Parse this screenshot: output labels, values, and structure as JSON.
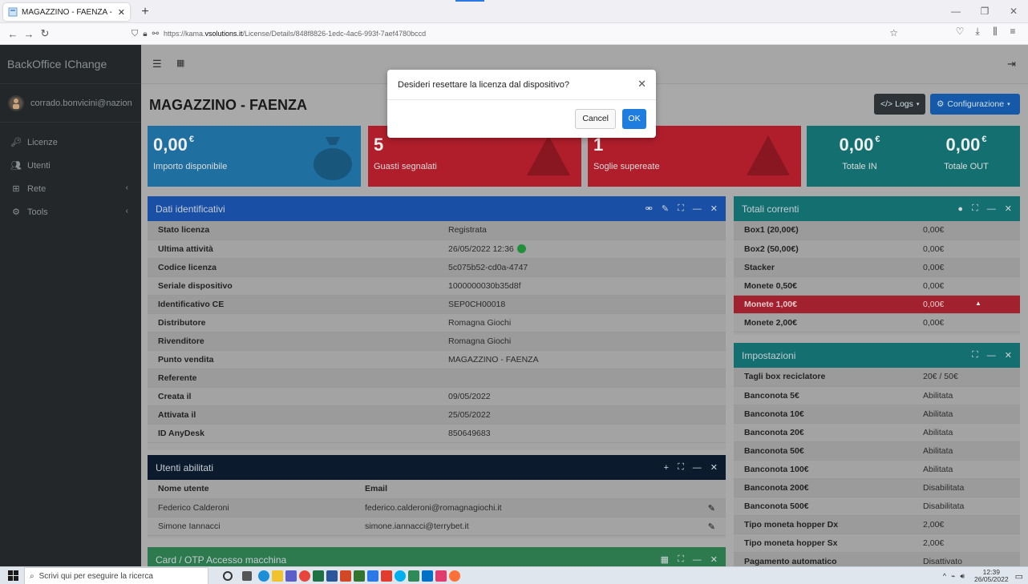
{
  "browser": {
    "tab_title": "MAGAZZINO - FAENZA - IChan",
    "url_prefix": "https://kama.",
    "url_domain": "vsolutions.it",
    "url_path": "/License/Details/848f8826-1edc-4ac6-993f-7aef4780bccd"
  },
  "sidebar": {
    "brand": "BackOffice IChange",
    "user": "corrado.bonvicini@nazion",
    "items": [
      {
        "label": "Licenze"
      },
      {
        "label": "Utenti"
      },
      {
        "label": "Rete"
      },
      {
        "label": "Tools"
      }
    ]
  },
  "page": {
    "title": "MAGAZZINO - FAENZA",
    "logs_label": "</> Logs",
    "config_label": "Configurazione"
  },
  "boxes": [
    {
      "value": "0,00",
      "unit": "€",
      "label": "Importo disponibile",
      "color": "#1f6fa0"
    },
    {
      "value": "5",
      "label": "Guasti segnalati",
      "color": "#b01e2b"
    },
    {
      "value": "1",
      "label": "Soglie supereate",
      "color": "#b01e2b"
    },
    {
      "value": "0,00",
      "unit": "€",
      "label": "Totale IN",
      "color": "#136f70"
    },
    {
      "value": "0,00",
      "unit": "€",
      "label": "Totale OUT",
      "color": "#136f70"
    }
  ],
  "dati": {
    "title": "Dati identificativi",
    "rows": [
      {
        "k": "Stato licenza",
        "v": "Registrata"
      },
      {
        "k": "Ultima attività",
        "v": "26/05/2022 12:36"
      },
      {
        "k": "Codice licenza",
        "v": "5c075b52-cd0a-4747"
      },
      {
        "k": "Seriale dispositivo",
        "v": "1000000030b35d8f"
      },
      {
        "k": "Identificativo CE",
        "v": "SEP0CH00018"
      },
      {
        "k": "Distributore",
        "v": "Romagna Giochi"
      },
      {
        "k": "Rivenditore",
        "v": "Romagna Giochi"
      },
      {
        "k": "Punto vendita",
        "v": "MAGAZZINO - FAENZA"
      },
      {
        "k": "Referente",
        "v": ""
      },
      {
        "k": "Creata il",
        "v": "09/05/2022"
      },
      {
        "k": "Attivata il",
        "v": "25/05/2022"
      },
      {
        "k": "ID AnyDesk",
        "v": "850649683"
      }
    ]
  },
  "utenti": {
    "title": "Utenti abilitati",
    "col_name": "Nome utente",
    "col_email": "Email",
    "rows": [
      {
        "name": "Federico Calderoni",
        "email": "federico.calderoni@romagnagiochi.it"
      },
      {
        "name": "Simone Iannacci",
        "email": "simone.iannacci@terrybet.it"
      }
    ]
  },
  "card": {
    "title": "Card / OTP Accesso macchina"
  },
  "totali": {
    "title": "Totali correnti",
    "rows": [
      {
        "k": "Box1 (20,00€)",
        "v": "0,00€"
      },
      {
        "k": "Box2 (50,00€)",
        "v": "0,00€"
      },
      {
        "k": "Stacker",
        "v": "0,00€"
      },
      {
        "k": "Monete 0,50€",
        "v": "0,00€"
      },
      {
        "k": "Monete 1,00€",
        "v": "0,00€"
      },
      {
        "k": "Monete 2,00€",
        "v": "0,00€"
      }
    ]
  },
  "impostazioni": {
    "title": "Impostazioni",
    "rows": [
      {
        "k": "Tagli box reciclatore",
        "v": "20€ / 50€"
      },
      {
        "k": "Banconota 5€",
        "v": "Abilitata"
      },
      {
        "k": "Banconota 10€",
        "v": "Abilitata"
      },
      {
        "k": "Banconota 20€",
        "v": "Abilitata"
      },
      {
        "k": "Banconota 50€",
        "v": "Abilitata"
      },
      {
        "k": "Banconota 100€",
        "v": "Abilitata"
      },
      {
        "k": "Banconota 200€",
        "v": "Disabilitata"
      },
      {
        "k": "Banconota 500€",
        "v": "Disabilitata"
      },
      {
        "k": "Tipo moneta hopper Dx",
        "v": "2,00€"
      },
      {
        "k": "Tipo moneta hopper Sx",
        "v": "2,00€"
      },
      {
        "k": "Pagamento automatico",
        "v": "Disattivato"
      }
    ]
  },
  "modal": {
    "message": "Desideri resettare la licenza dal dispositivo?",
    "cancel": "Cancel",
    "ok": "OK"
  },
  "taskbar": {
    "search_placeholder": "Scrivi qui per eseguire la ricerca",
    "time": "12:39",
    "date": "26/05/2022"
  }
}
